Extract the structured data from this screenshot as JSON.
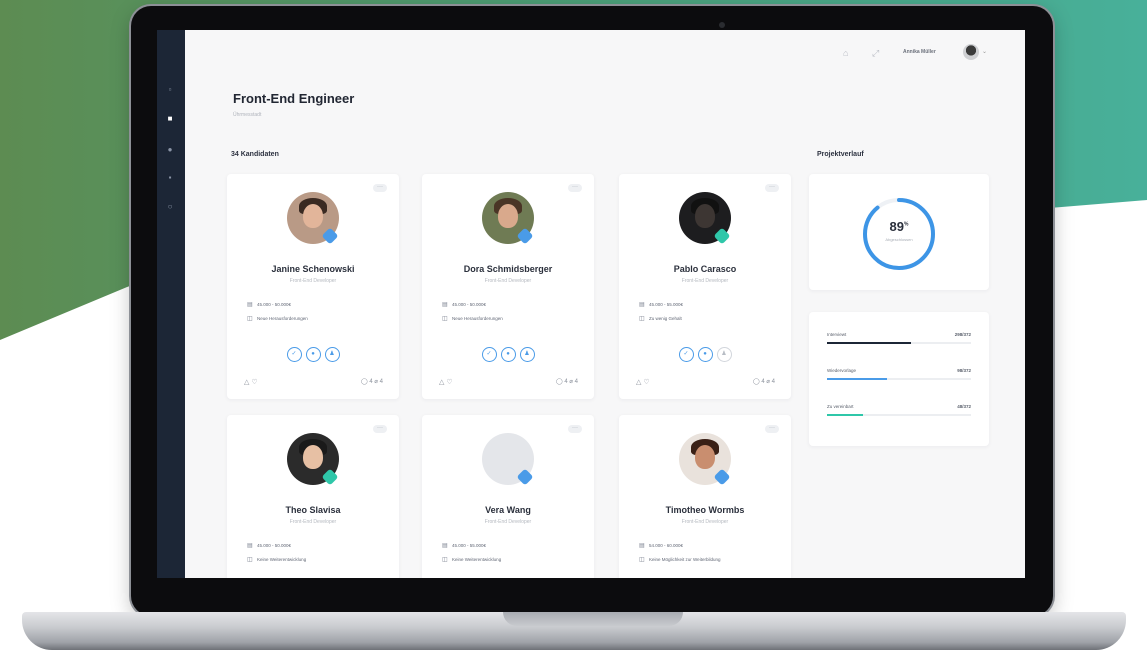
{
  "theme": {
    "sidebar_bg": "#1c2636",
    "accent_blue": "#4a9be8",
    "accent_teal": "#2fc7a9",
    "background_teal": "#3fae94"
  },
  "sidebar": {
    "icons": [
      {
        "name": "home-icon",
        "glyph": "▫"
      },
      {
        "name": "briefcase-icon",
        "glyph": "■"
      },
      {
        "name": "users-icon",
        "glyph": "●"
      },
      {
        "name": "calendar-icon",
        "glyph": "▪"
      },
      {
        "name": "settings-icon",
        "glyph": "○"
      }
    ]
  },
  "topbar": {
    "notification_glyph": "⌂",
    "expand_glyph": "⤢",
    "user_name": "Annika Müller",
    "caret": "⌄"
  },
  "page": {
    "title": "Front-End Engineer",
    "subtitle": "Ührmesstadt"
  },
  "candidates_section": {
    "title": "34 Kandidaten"
  },
  "progress_section": {
    "title": "Projektverlauf"
  },
  "candidates": [
    {
      "name": "Janine Schenowski",
      "role": "Front-End Developer",
      "salary": "45.000 - 50.000€",
      "note": "Neue Herausforderungen",
      "badge_color": "#4a9be8",
      "avatar_bg": "#b99a86",
      "face": "#e2b59a",
      "hair": "#3a2a22",
      "footer_right": "◯ 4   ⌀ 4"
    },
    {
      "name": "Dora Schmidsberger",
      "role": "Front-End Developer",
      "salary": "45.000 - 50.000€",
      "note": "Neue Herausforderungen",
      "badge_color": "#4a9be8",
      "avatar_bg": "#6f7b54",
      "face": "#d9a98c",
      "hair": "#4a3526",
      "footer_right": "◯ 4   ⌀ 4"
    },
    {
      "name": "Pablo Carasco",
      "role": "Front-End Developer",
      "salary": "45.000 - 55.000€",
      "note": "Zu wenig Gehalt",
      "badge_color": "#2fc7a9",
      "avatar_bg": "#1d1d1f",
      "face": "#3d3633",
      "hair": "#111111",
      "footer_right": "◯ 4   ⌀ 4"
    },
    {
      "name": "Theo Slavisa",
      "role": "Front-End Developer",
      "salary": "45.000 - 50.000€",
      "note": "Keine Weiterentwicklung",
      "badge_color": "#2fc7a9",
      "avatar_bg": "#2b2b2b",
      "face": "#e7c0a4",
      "hair": "#1a1a1a",
      "footer_right": ""
    },
    {
      "name": "Vera Wang",
      "role": "Front-End Developer",
      "salary": "45.000 - 55.000€",
      "note": "Keine Weiterentwicklung",
      "badge_color": "#4a9be8",
      "avatar_bg": "#e4e6ea",
      "face": "#e4e6ea",
      "hair": "#e4e6ea",
      "footer_right": ""
    },
    {
      "name": "Timotheo Wormbs",
      "role": "Front-End Developer",
      "salary": "54.000 - 60.000€",
      "note": "Keine Möglichkeit zur Weiterbildung",
      "badge_color": "#4a9be8",
      "avatar_bg": "#e9e2dc",
      "face": "#c98e6f",
      "hair": "#3a2016",
      "footer_right": ""
    }
  ],
  "card_actions": {
    "menu_glyph": "···",
    "salary_icon": "▤",
    "note_icon": "◫",
    "btn1": "✓",
    "btn2": "●",
    "btn3": "♟",
    "footer_left": "△ ♡"
  },
  "progress": {
    "value": "89",
    "unit": "%",
    "percent": 89,
    "label": "Abgeschlossen"
  },
  "stats": [
    {
      "label": "Interviewt",
      "value": "298/372",
      "fraction": 0.58,
      "color": "#1c2636"
    },
    {
      "label": "Wiedervorlage",
      "value": "98/372",
      "fraction": 0.42,
      "color": "#4a9be8"
    },
    {
      "label": "Zu vereinbart",
      "value": "48/372",
      "fraction": 0.25,
      "color": "#2fc7a9"
    }
  ]
}
